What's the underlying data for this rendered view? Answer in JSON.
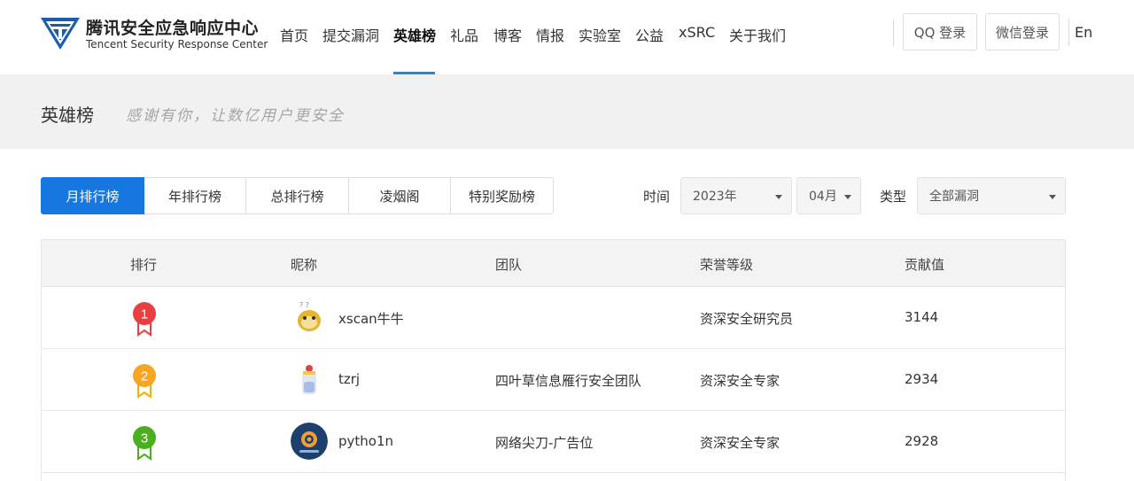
{
  "header": {
    "brand_cn": "腾讯安全应急响应中心",
    "brand_en": "Tencent Security Response Center",
    "nav": [
      {
        "label": "首页"
      },
      {
        "label": "提交漏洞"
      },
      {
        "label": "英雄榜",
        "active": true
      },
      {
        "label": "礼品"
      },
      {
        "label": "博客"
      },
      {
        "label": "情报"
      },
      {
        "label": "实验室"
      },
      {
        "label": "公益"
      },
      {
        "label": "xSRC"
      },
      {
        "label": "关于我们"
      }
    ],
    "qq_login": "QQ 登录",
    "wechat_login": "微信登录",
    "lang": "En"
  },
  "banner": {
    "title": "英雄榜",
    "slogan": "感谢有你，让数亿用户更安全"
  },
  "tabs": [
    {
      "label": "月排行榜",
      "active": true
    },
    {
      "label": "年排行榜"
    },
    {
      "label": "总排行榜"
    },
    {
      "label": "凌烟阁"
    },
    {
      "label": "特别奖励榜"
    }
  ],
  "filters": {
    "time_label": "时间",
    "year": "2023年",
    "month": "04月",
    "type_label": "类型",
    "type": "全部漏洞"
  },
  "table": {
    "columns": [
      "排行",
      "昵称",
      "团队",
      "荣誉等级",
      "贡献值"
    ],
    "rows": [
      {
        "rank": "1",
        "nickname": "xscan牛牛",
        "team": "",
        "level": "资深安全研究员",
        "score": "3144",
        "medal_color": "#e84040",
        "ribbon_color": "#e84040"
      },
      {
        "rank": "2",
        "nickname": "tzrj",
        "team": "四叶草信息雁行安全团队",
        "level": "资深安全专家",
        "score": "2934",
        "medal_color": "#f5a623",
        "ribbon_color": "#f0b400"
      },
      {
        "rank": "3",
        "nickname": "pytho1n",
        "team": "网络尖刀-广告位",
        "level": "资深安全专家",
        "score": "2928",
        "medal_color": "#4caf1f",
        "ribbon_color": "#4caf1f"
      }
    ]
  },
  "colors": {
    "accent": "#1677e0",
    "logo_blue": "#1a5dad"
  }
}
